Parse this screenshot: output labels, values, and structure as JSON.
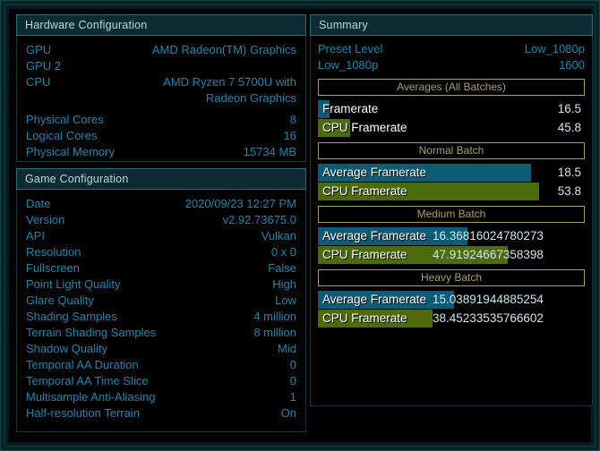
{
  "hardware": {
    "title": "Hardware Configuration",
    "rows": [
      {
        "label": "GPU",
        "value": "AMD Radeon(TM) Graphics"
      },
      {
        "label": "GPU 2",
        "value": ""
      },
      {
        "label": "CPU",
        "value": "AMD Ryzen 7 5700U with"
      },
      {
        "label": "",
        "value": "Radeon Graphics"
      },
      {
        "label": "Physical Cores",
        "value": "8"
      },
      {
        "label": "Logical Cores",
        "value": "16"
      },
      {
        "label": "Physical Memory",
        "value": "15734 MB"
      }
    ]
  },
  "game": {
    "title": "Game Configuration",
    "rows": [
      {
        "label": "Date",
        "value": "2020/09/23 12:27 PM"
      },
      {
        "label": "Version",
        "value": "v2.92.73675.0"
      },
      {
        "label": "API",
        "value": "Vulkan"
      },
      {
        "label": "Resolution",
        "value": "0 x 0"
      },
      {
        "label": "Fullscreen",
        "value": "False"
      },
      {
        "label": "Point Light Quality",
        "value": "High"
      },
      {
        "label": "Glare Quality",
        "value": "Low"
      },
      {
        "label": "Shading Samples",
        "value": "4 million"
      },
      {
        "label": "Terrain Shading Samples",
        "value": "8 million"
      },
      {
        "label": "Shadow Quality",
        "value": "Mid"
      },
      {
        "label": "Temporal AA Duration",
        "value": "0"
      },
      {
        "label": "Temporal AA Time Slice",
        "value": "0"
      },
      {
        "label": "Multisample Anti-Aliasing",
        "value": "1"
      },
      {
        "label": "Half-resolution Terrain",
        "value": "On"
      }
    ]
  },
  "summary": {
    "title": "Summary",
    "rows": [
      {
        "label": "Preset Level",
        "value": "Low_1080p"
      },
      {
        "label": "Low_1080p",
        "value": "1600"
      }
    ],
    "sections": [
      {
        "heading": "Averages (All Batches)",
        "metrics": [
          {
            "label": "Framerate",
            "value": "16.5",
            "fill_pct": 4.5,
            "kind": "gpu",
            "value_pos": "right"
          },
          {
            "label": "CPU Framerate",
            "value": "45.8",
            "fill_pct": 12.0,
            "kind": "cpu",
            "value_pos": "right"
          }
        ]
      },
      {
        "heading": "Normal Batch",
        "metrics": [
          {
            "label": "Average Framerate",
            "value": "18.5",
            "fill_pct": 80.0,
            "kind": "gpu",
            "value_pos": "right"
          },
          {
            "label": "CPU Framerate",
            "value": "53.8",
            "fill_pct": 83.0,
            "kind": "cpu",
            "value_pos": "right"
          }
        ]
      },
      {
        "heading": "Medium Batch",
        "metrics": [
          {
            "label": "Average Framerate",
            "value": "16.36816024780273",
            "fill_pct": 56.0,
            "kind": "gpu",
            "value_pos": "mid"
          },
          {
            "label": "CPU Framerate",
            "value": "47.91924667358398",
            "fill_pct": 71.0,
            "kind": "cpu",
            "value_pos": "mid"
          }
        ]
      },
      {
        "heading": "Heavy Batch",
        "metrics": [
          {
            "label": "Average Framerate",
            "value": "15.03891944885254",
            "fill_pct": 51.0,
            "kind": "gpu",
            "value_pos": "mid"
          },
          {
            "label": "CPU Framerate",
            "value": "38.45233535766602",
            "fill_pct": 43.0,
            "kind": "cpu",
            "value_pos": "mid"
          }
        ]
      }
    ]
  },
  "colors": {
    "accent_label": "#1f86ad",
    "gpu_bar": "#0d5c76",
    "cpu_bar": "#4c6b0c",
    "section_head": "#a6a062",
    "panel_head_bg": "#0d2b33",
    "panel_head_border": "#2d6c78"
  }
}
